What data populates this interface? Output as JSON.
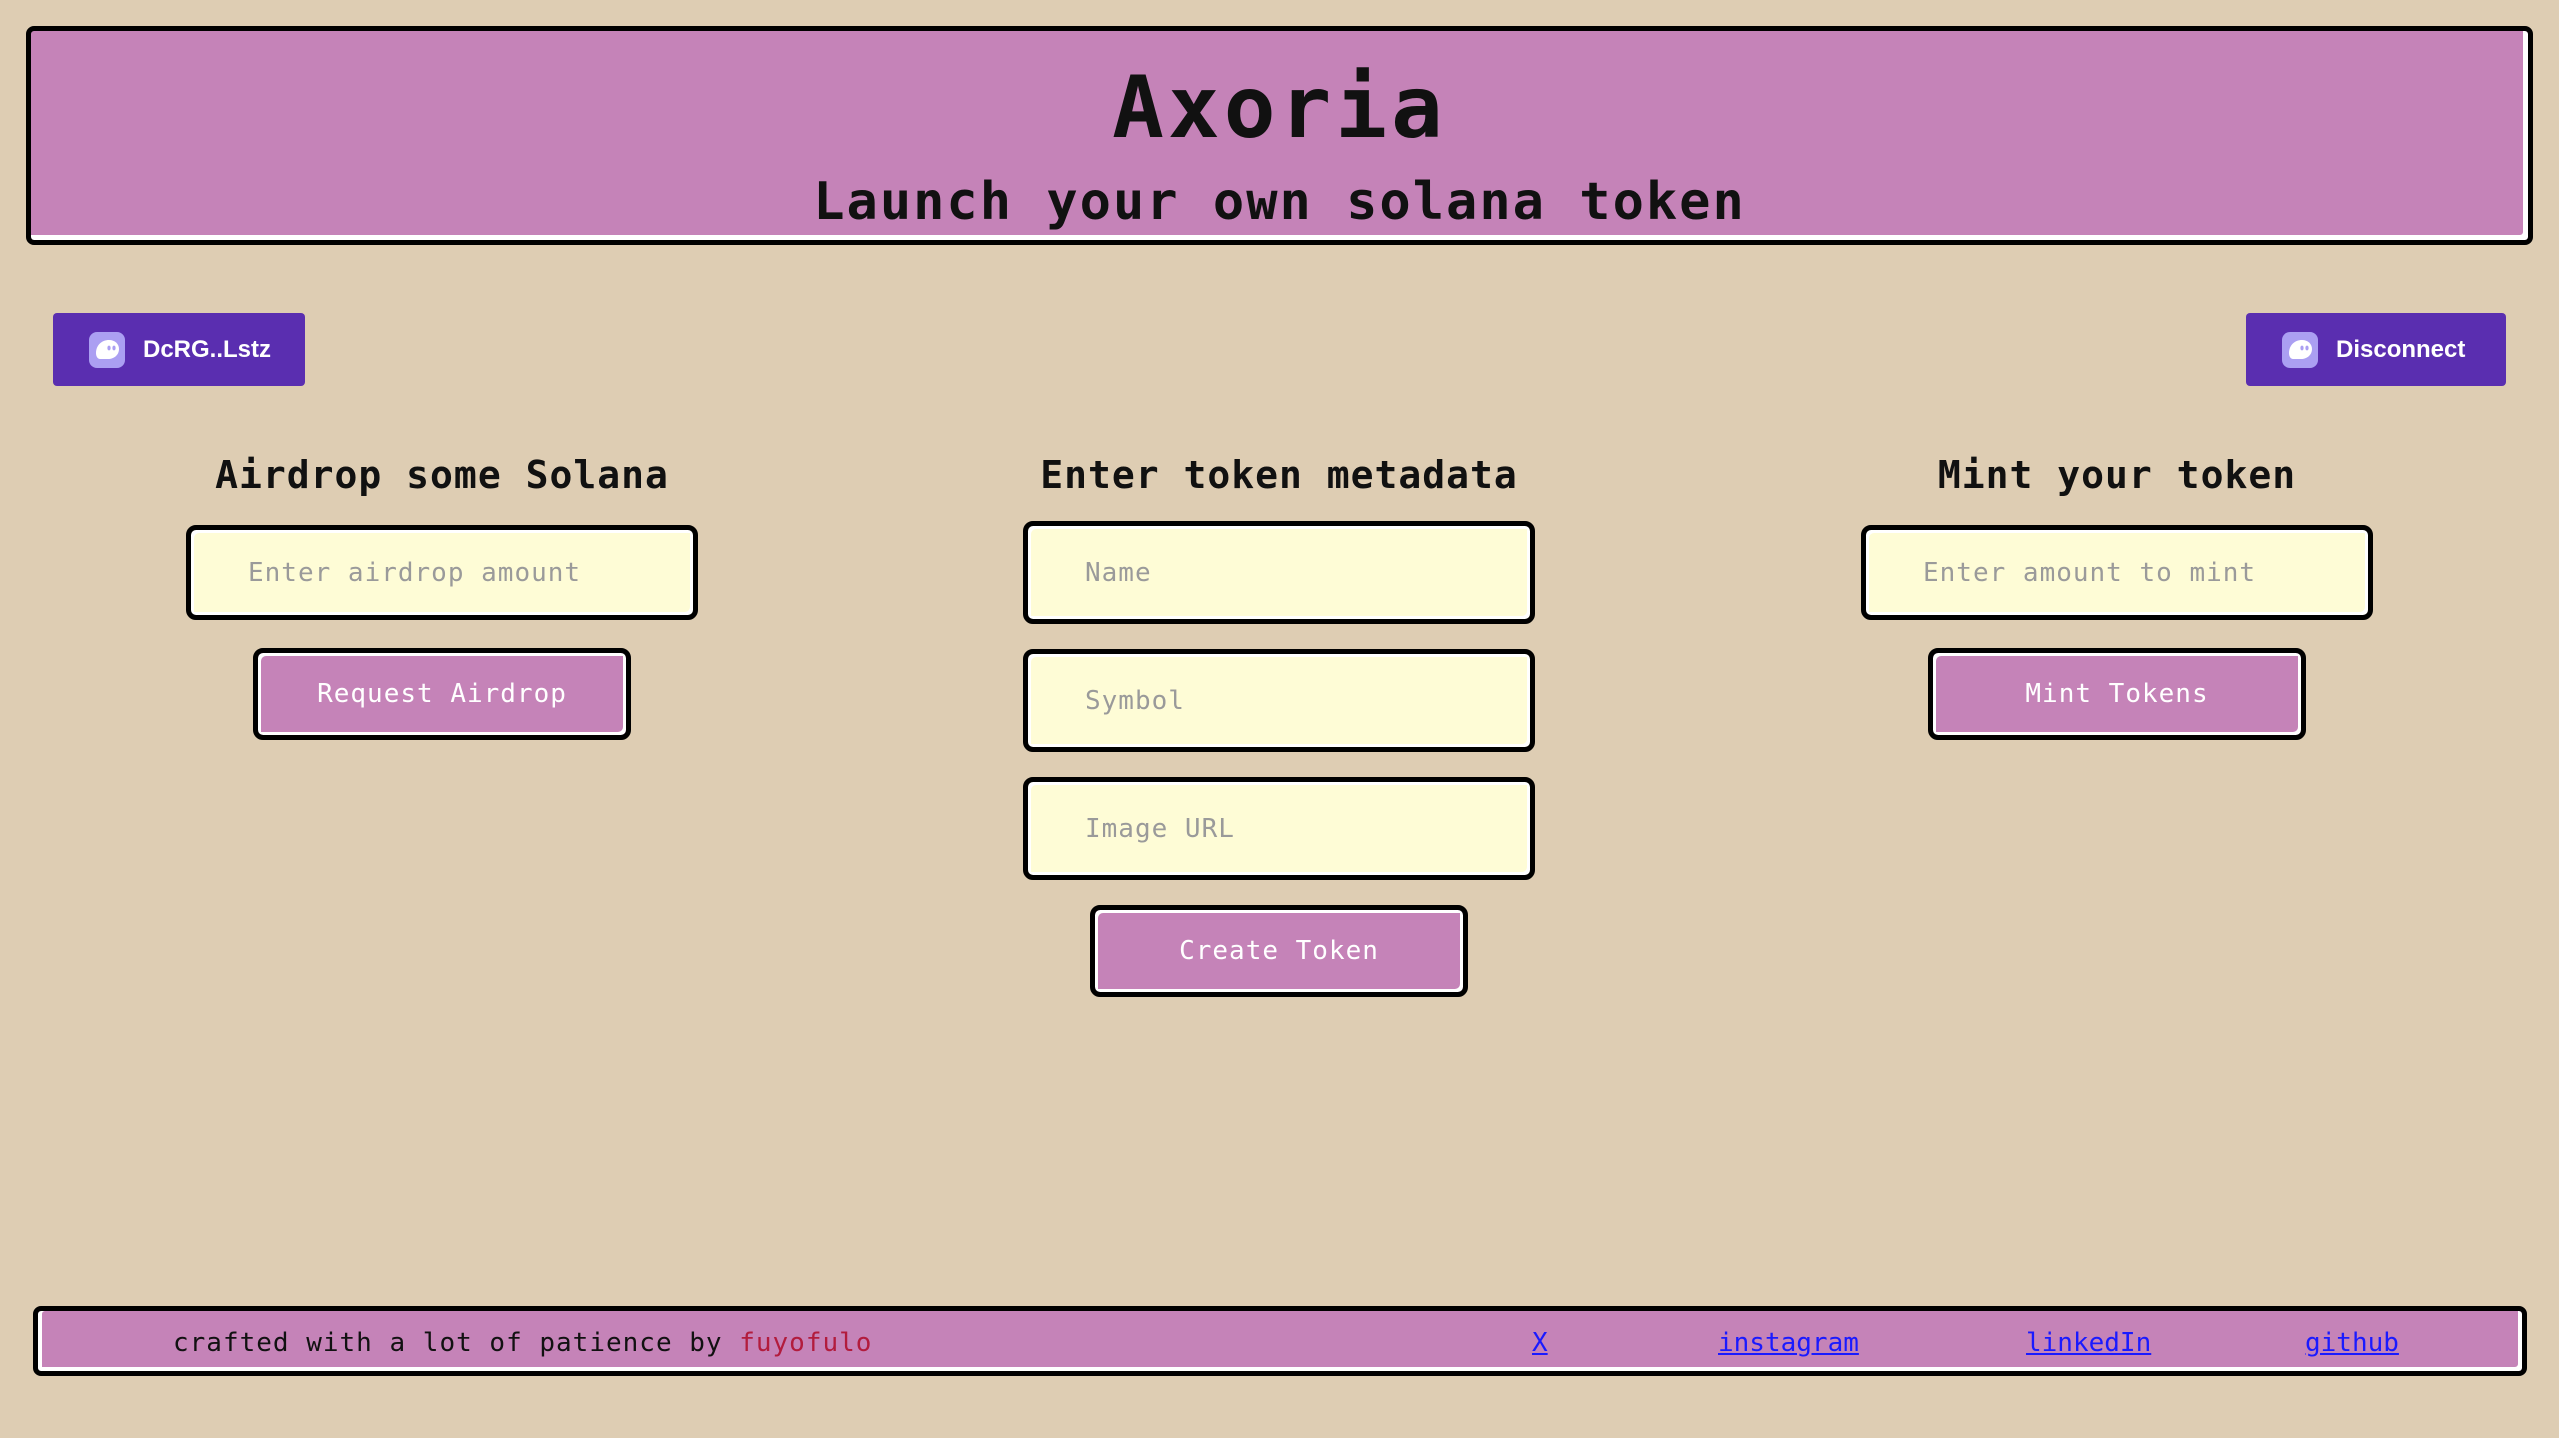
{
  "header": {
    "title": "Axoria",
    "subtitle": "Launch your own solana token"
  },
  "wallet": {
    "address_label": "DcRG..Lstz",
    "disconnect_label": "Disconnect",
    "icon": "phantom-ghost-icon",
    "color": "#5a2eb0"
  },
  "airdrop": {
    "title": "Airdrop some Solana",
    "amount_placeholder": "Enter airdrop amount",
    "amount_value": "",
    "button_label": "Request Airdrop"
  },
  "metadata": {
    "title": "Enter token metadata",
    "name_placeholder": "Name",
    "symbol_placeholder": "Symbol",
    "image_placeholder": "Image URL",
    "button_label": "Create Token"
  },
  "mint": {
    "title": "Mint your token",
    "amount_placeholder": "Enter amount to mint",
    "button_label": "Mint Tokens"
  },
  "footer": {
    "credit_prefix": "crafted with a lot of patience by ",
    "author": "fuyofulo",
    "links": [
      "X",
      "instagram",
      "linkedIn",
      "github"
    ]
  },
  "colors": {
    "background": "#decdb3",
    "accent": "#c583b8",
    "input_bg": "#fefcd6",
    "author": "#b21c3d",
    "link": "#1a1aff"
  }
}
